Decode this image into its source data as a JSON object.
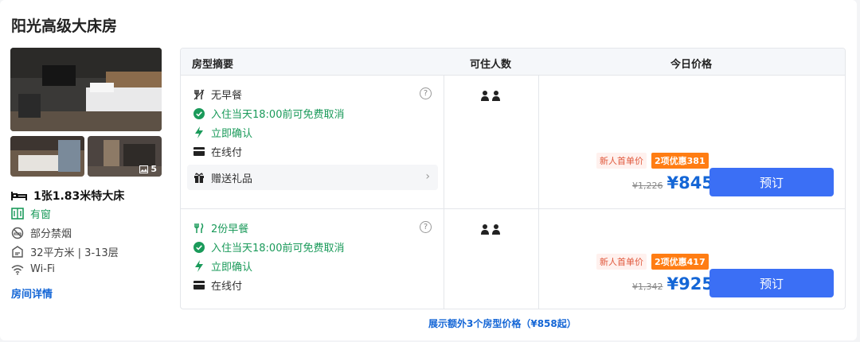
{
  "room": {
    "title": "阳光高级大床房",
    "photo_count": "5",
    "bed": "1张1.83米特大床",
    "features": [
      {
        "icon": "window-icon",
        "label": "有窗"
      },
      {
        "icon": "no-smoking-icon",
        "label": "部分禁烟"
      },
      {
        "icon": "floor-area-icon",
        "label": "32平方米 | 3-13层"
      },
      {
        "icon": "wifi-icon",
        "label": "Wi-Fi"
      }
    ],
    "detail_link": "房间详情"
  },
  "table": {
    "headers": {
      "summary": "房型摘要",
      "occupancy": "可住人数",
      "price": "今日价格"
    },
    "rows": [
      {
        "meal": "无早餐",
        "cancel": "入住当天18:00前可免费取消",
        "confirm": "立即确认",
        "payment": "在线付",
        "gift": "赠送礼品",
        "badge_new": "新人首单价",
        "badge_discount": "2项优惠381",
        "old_price": "¥1,226",
        "price": "¥845",
        "book": "预订"
      },
      {
        "meal": "2份早餐",
        "cancel": "入住当天18:00前可免费取消",
        "confirm": "立即确认",
        "payment": "在线付",
        "badge_new": "新人首单价",
        "badge_discount": "2项优惠417",
        "old_price": "¥1,342",
        "price": "¥925",
        "book": "预订"
      }
    ]
  },
  "more_link": "展示额外3个房型价格（¥858起）",
  "colors": {
    "accent": "#3b6ff5",
    "link": "#1466d6",
    "green": "#1a9a5a",
    "discount": "#ff7d13"
  }
}
